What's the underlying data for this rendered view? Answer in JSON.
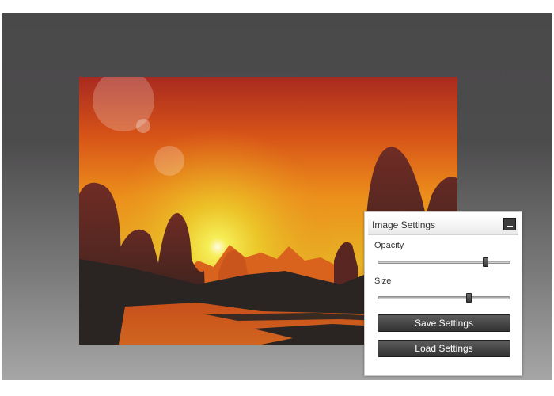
{
  "panel": {
    "title": "Image Settings",
    "collapse_icon": "minimize-icon",
    "opacity": {
      "label": "Opacity",
      "value_fraction": 0.82
    },
    "size": {
      "label": "Size",
      "value_fraction": 0.69
    },
    "save_label": "Save Settings",
    "load_label": "Load Settings"
  },
  "colors": {
    "background_top": "#4a494a",
    "background_bottom": "#a6a6a6",
    "button": "#3d3d3d",
    "sky_top": "#b02a1e",
    "sky_mid": "#e8921a",
    "sun": "#f4e64a",
    "mountain": "#6a2b22",
    "foreground": "#2a2523"
  }
}
